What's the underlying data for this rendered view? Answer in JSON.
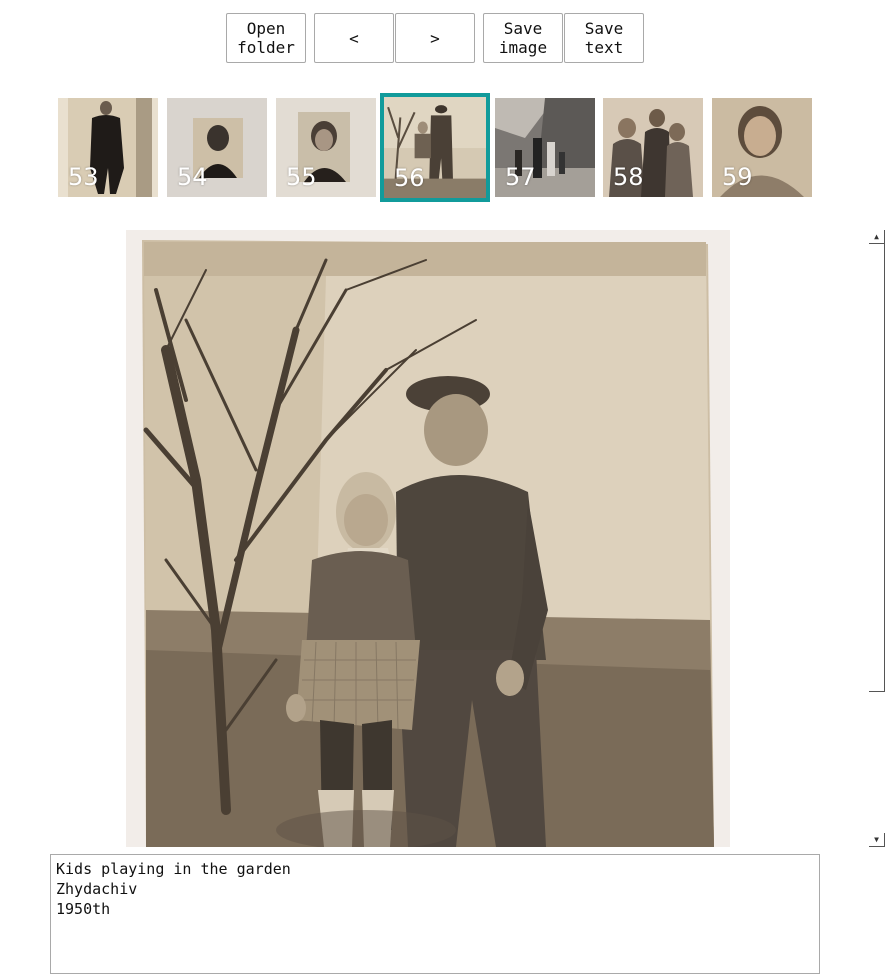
{
  "toolbar": {
    "open_folder_label": "Open\nfolder",
    "prev_label": "<",
    "next_label": ">",
    "save_image_label": "Save\nimage",
    "save_text_label": "Save\ntext"
  },
  "thumbnails": [
    {
      "number": "53",
      "selected": false
    },
    {
      "number": "54",
      "selected": false
    },
    {
      "number": "55",
      "selected": false
    },
    {
      "number": "56",
      "selected": true
    },
    {
      "number": "57",
      "selected": false
    },
    {
      "number": "58",
      "selected": false
    },
    {
      "number": "59",
      "selected": false
    }
  ],
  "selection_color": "#119b9b",
  "caption": {
    "line1": "Kids playing in the garden",
    "line2": "Zhydachiv",
    "line3": "1950th"
  },
  "scrollbar": {
    "up_icon": "triangle-up-icon",
    "down_icon": "triangle-down-icon"
  }
}
